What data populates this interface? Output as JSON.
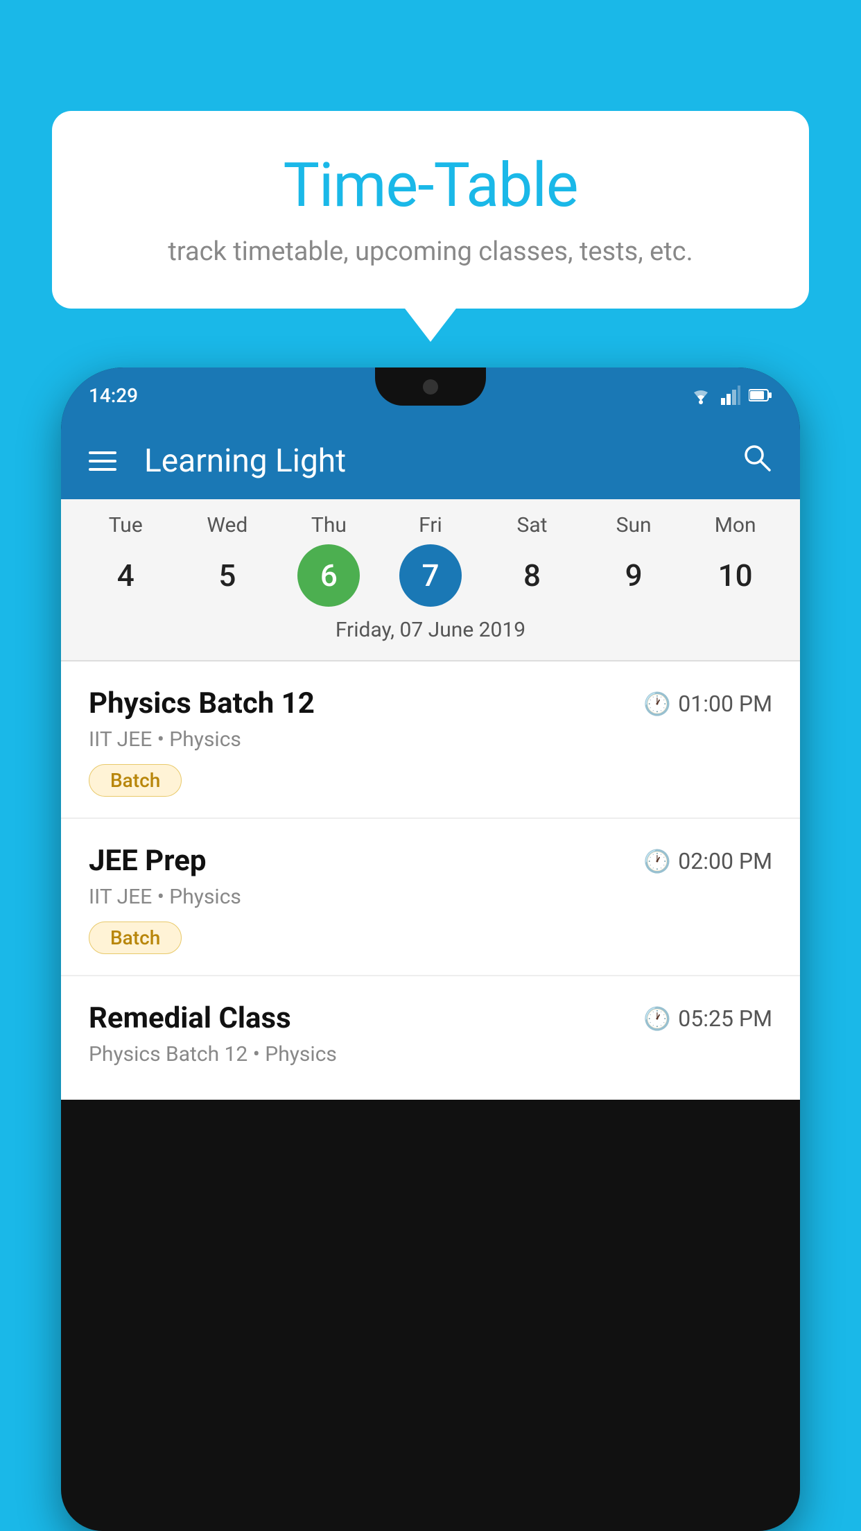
{
  "background_color": "#1ab8e8",
  "speech_bubble": {
    "title": "Time-Table",
    "subtitle": "track timetable, upcoming classes, tests, etc."
  },
  "phone": {
    "status_bar": {
      "time": "14:29"
    },
    "app_bar": {
      "title": "Learning Light"
    },
    "calendar": {
      "days": [
        {
          "label": "Tue",
          "num": "4"
        },
        {
          "label": "Wed",
          "num": "5"
        },
        {
          "label": "Thu",
          "num": "6",
          "state": "today"
        },
        {
          "label": "Fri",
          "num": "7",
          "state": "selected"
        },
        {
          "label": "Sat",
          "num": "8"
        },
        {
          "label": "Sun",
          "num": "9"
        },
        {
          "label": "Mon",
          "num": "10"
        }
      ],
      "selected_date": "Friday, 07 June 2019"
    },
    "classes": [
      {
        "title": "Physics Batch 12",
        "time": "01:00 PM",
        "subtitle": "IIT JEE • Physics",
        "badge": "Batch"
      },
      {
        "title": "JEE Prep",
        "time": "02:00 PM",
        "subtitle": "IIT JEE • Physics",
        "badge": "Batch"
      },
      {
        "title": "Remedial Class",
        "time": "05:25 PM",
        "subtitle": "Physics Batch 12 • Physics",
        "badge": null
      }
    ]
  }
}
